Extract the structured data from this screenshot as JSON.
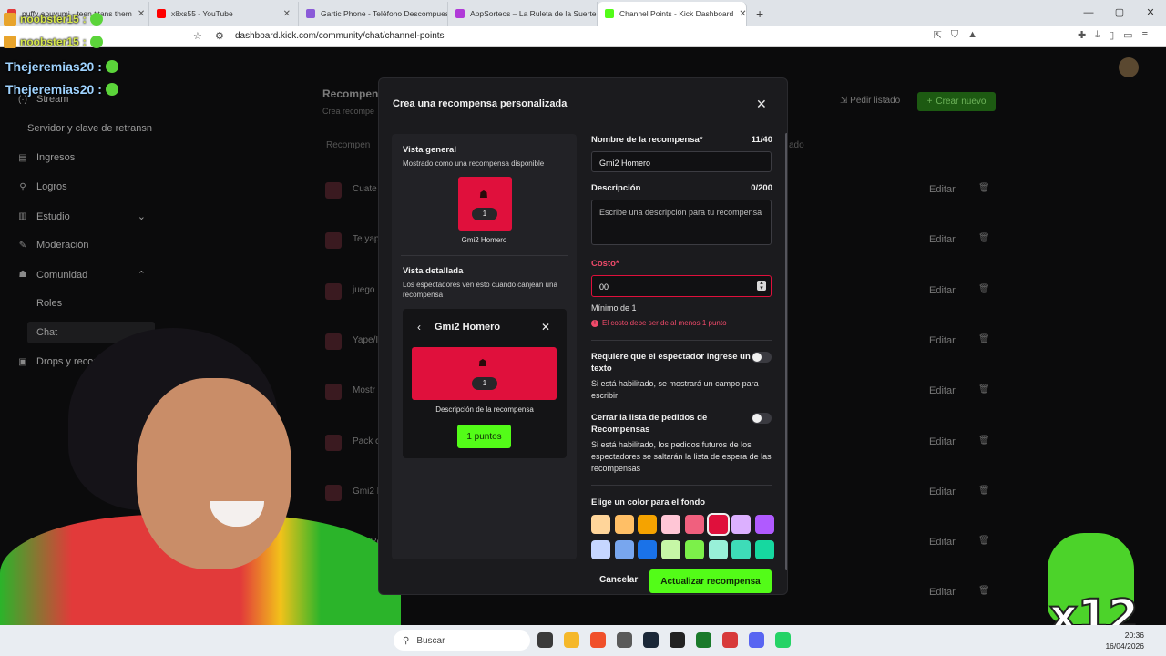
{
  "browser": {
    "tabs": [
      {
        "label": "puffy apuyumi - teen titans them",
        "color": "#e23a3a"
      },
      {
        "label": "x8xs55 - YouTube",
        "color": "#ff0000"
      },
      {
        "label": "Gartic Phone - Teléfono Descompues",
        "color": "#8a5ad8"
      },
      {
        "label": "AppSorteos – La Ruleta de la Suerte",
        "color": "#b03ad8"
      },
      {
        "label": "Channel Points - Kick Dashboard",
        "color": "#53fc18",
        "active": true
      }
    ],
    "new_tab": "+",
    "url": "dashboard.kick.com/community/chat/channel-points",
    "window_controls": [
      "—",
      "▢",
      "✕"
    ]
  },
  "chat_overlay": [
    {
      "name": "noobster15",
      "suffix": ":"
    },
    {
      "name": "noobster15",
      "suffix": ":"
    },
    {
      "name": "Thejeremias20",
      "suffix": ":"
    },
    {
      "name": "Thejeremias20",
      "suffix": ":"
    }
  ],
  "sidebar": {
    "items": [
      {
        "label": "Stream",
        "icon": "(·)"
      },
      {
        "label": "Servidor y clave de retransn",
        "icon": ""
      },
      {
        "label": "Ingresos",
        "icon": "▤"
      },
      {
        "label": "Logros",
        "icon": "⚲"
      },
      {
        "label": "Estudio",
        "icon": "▥",
        "chevron": "⌄"
      },
      {
        "label": "Moderación",
        "icon": "✎"
      },
      {
        "label": "Comunidad",
        "icon": "☗",
        "chevron": "⌃"
      },
      {
        "label": "Roles",
        "icon": ""
      },
      {
        "label": "Chat",
        "icon": ""
      },
      {
        "label": "Drops y recom",
        "icon": "▣"
      }
    ]
  },
  "dashboard": {
    "title": "Recompen",
    "subtitle": "Crea recompe",
    "col_name": "Recompen",
    "col_state": "ado",
    "pedir_listado": "Pedir listado",
    "crear_nuevo": "Crear nuevo",
    "rows": [
      "Cuate",
      "Te yap",
      "juego",
      "Yape/I",
      "Mostr",
      "Pack c",
      "Gmi2 I",
      "500 Re",
      "DE"
    ],
    "edit_label": "Editar"
  },
  "modal": {
    "title": "Crea una recompensa personalizada",
    "close": "✕",
    "overview_title": "Vista general",
    "overview_sub": "Mostrado como una recompensa disponible",
    "card_cost": "1",
    "card_name": "Gmi2 Homero",
    "detail_title": "Vista detallada",
    "detail_sub": "Los espectadores ven esto cuando canjean una recompensa",
    "detail_header": "Gmi2 Homero",
    "detail_desc": "Descripción de la recompensa",
    "detail_button": "1 puntos",
    "name_label": "Nombre de la recompensa*",
    "name_count": "11/40",
    "name_value": "Gmi2 Homero",
    "desc_label": "Descripción",
    "desc_count": "0/200",
    "desc_placeholder": "Escribe una descripción para tu recompensa",
    "cost_label": "Costo*",
    "cost_value": "00",
    "cost_min": "Mínimo de 1",
    "cost_error": "El costo debe ser de al menos 1 punto",
    "toggle1_label": "Requiere que el espectador ingrese un texto",
    "toggle1_desc": "Si está habilitado, se mostrará un campo para escribir",
    "toggle2_label": "Cerrar la lista de pedidos de Recompensas",
    "toggle2_desc": "Si está habilitado, los pedidos futuros de los espectadores se saltarán la lista de espera de las recompensas",
    "color_label": "Elige un color para el fondo",
    "colors_row1": [
      "#ffd59a",
      "#ffbf66",
      "#f5a300",
      "#ffc6d6",
      "#f0607e",
      "#e0103c",
      "#dcb0ff",
      "#b05aff"
    ],
    "colors_row2": [
      "#c6d6ff",
      "#78a6ee",
      "#1a72e8",
      "#c6f7a6",
      "#7cf04a",
      "#98f0d8",
      "#3edcb8",
      "#16d8a0"
    ],
    "selected_color": "#e0103c",
    "cancel": "Cancelar",
    "submit": "Actualizar recompensa"
  },
  "taskbar": {
    "search": "Buscar",
    "time": "20:36",
    "date": "16/04/2026"
  },
  "sticker_text": "x12"
}
